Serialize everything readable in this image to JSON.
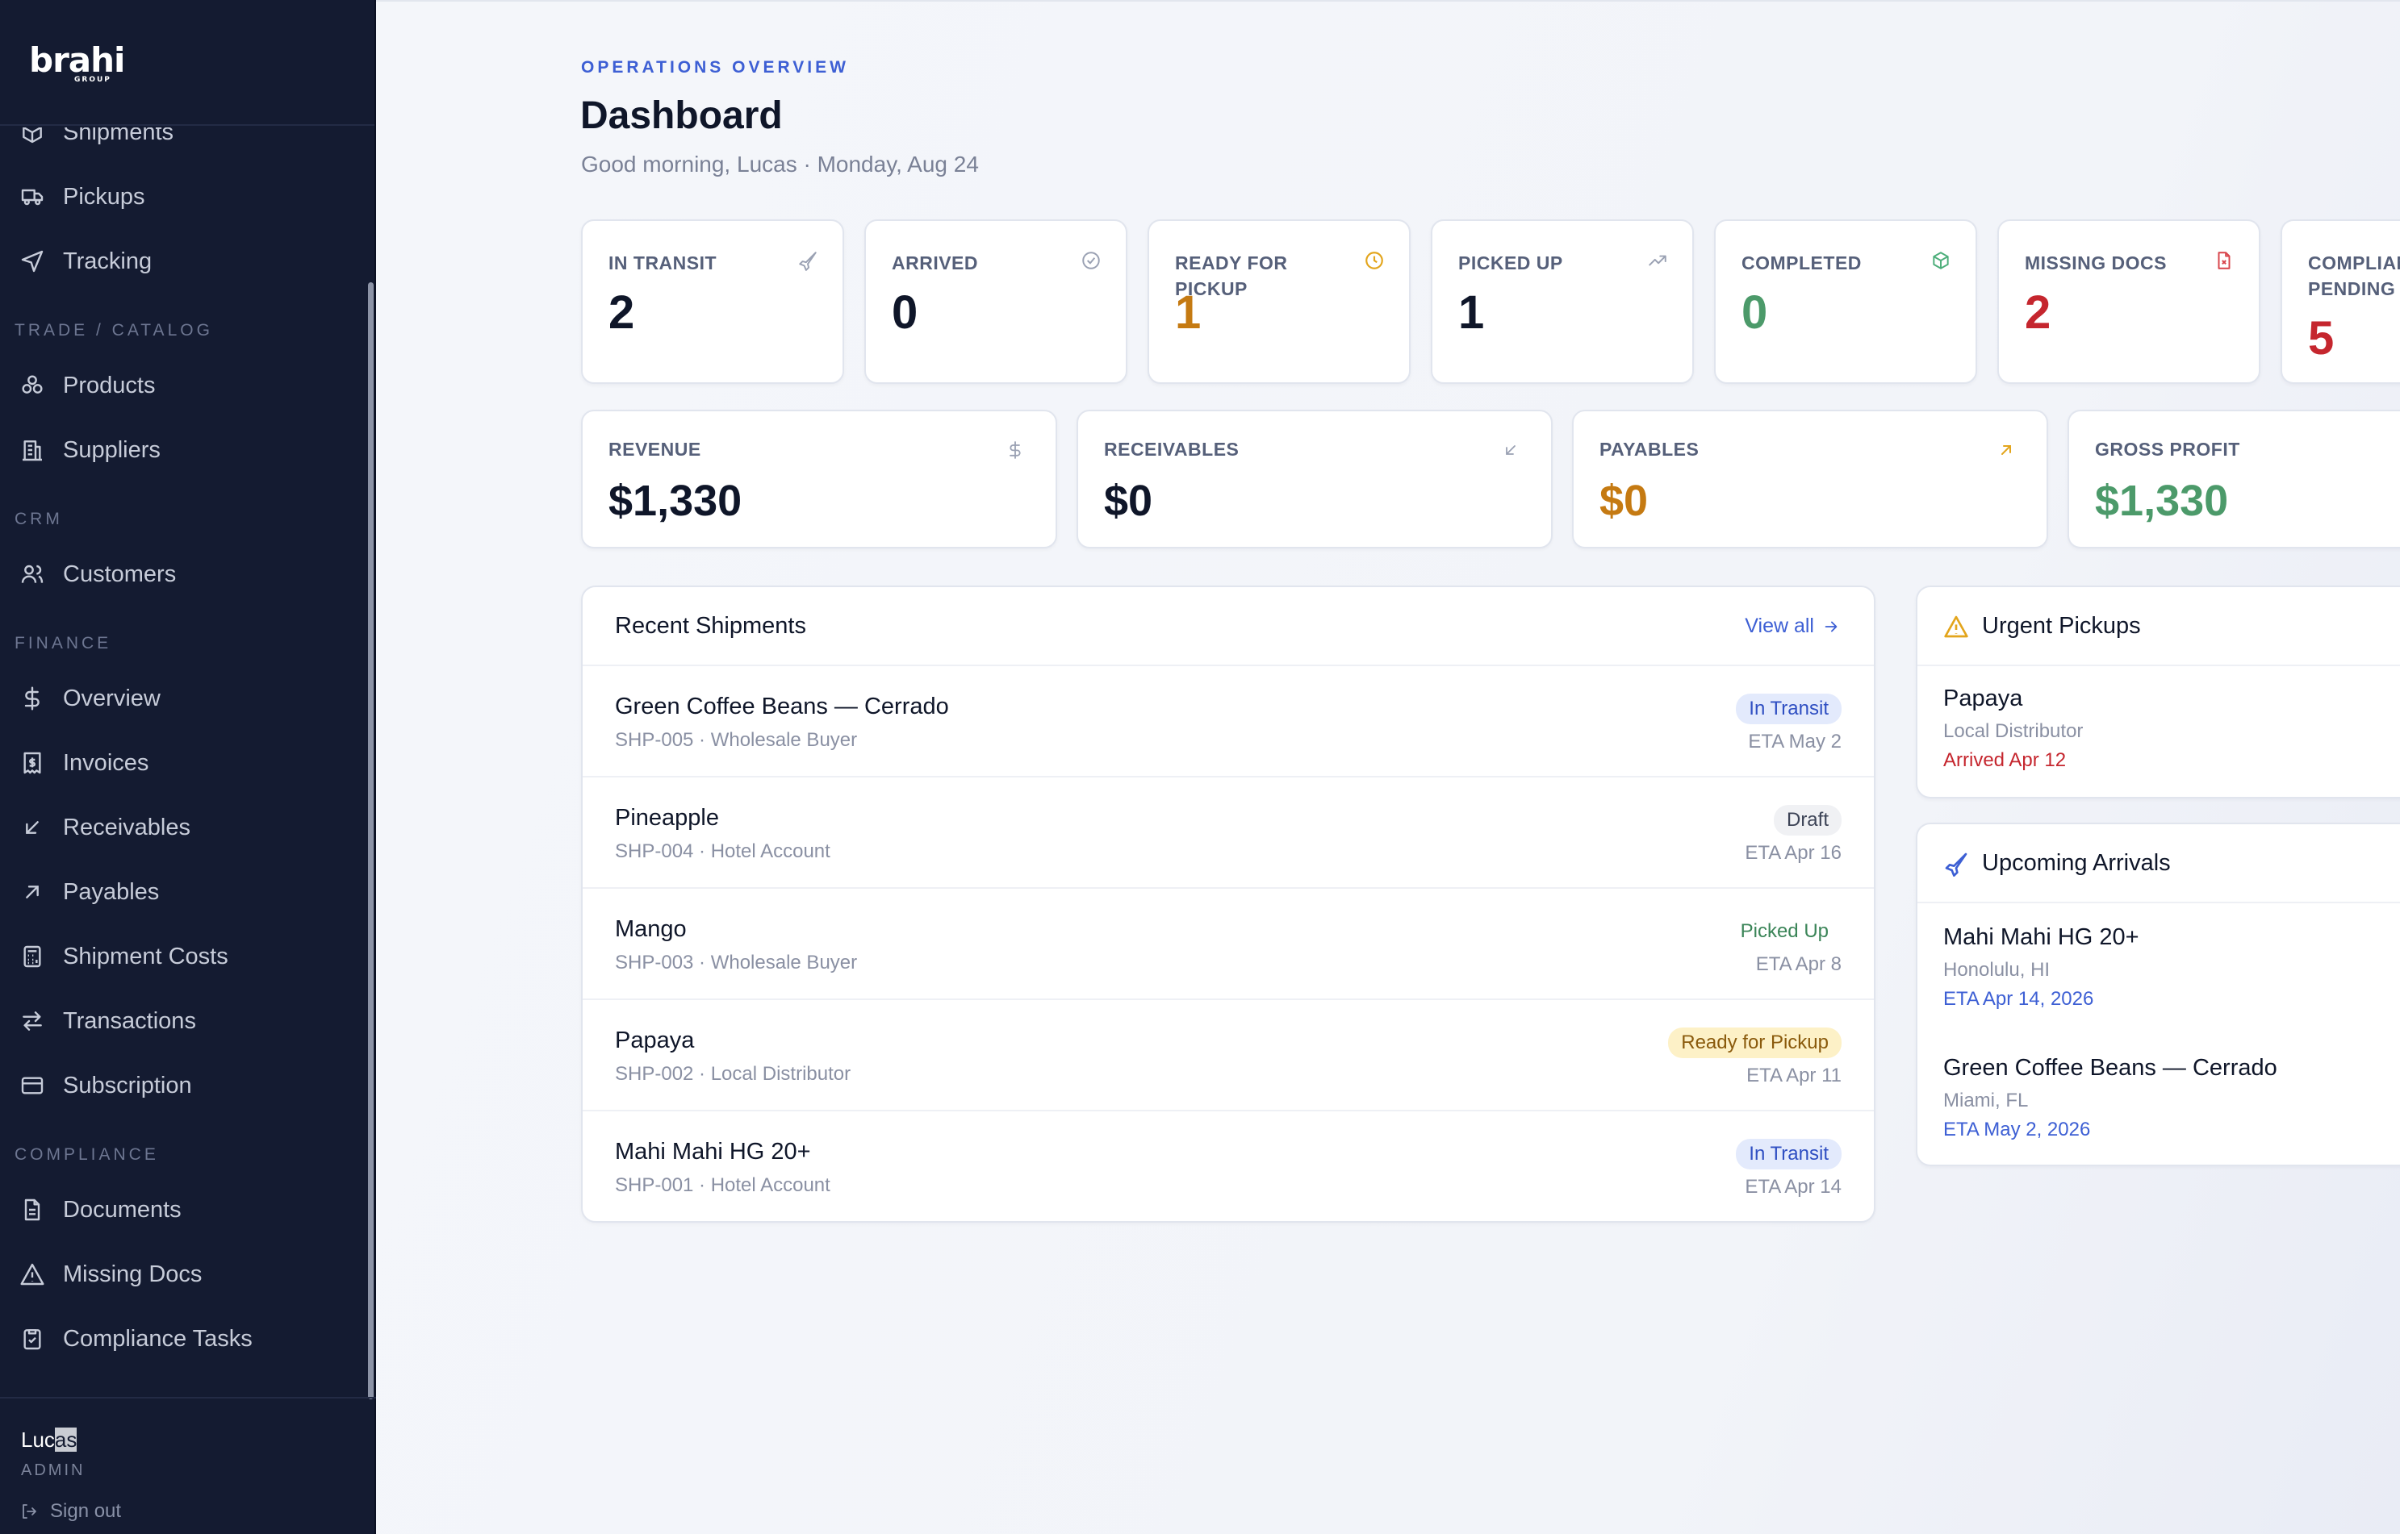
{
  "brand": {
    "wordmark": "brahi",
    "sub": "GROUP"
  },
  "sidebar": {
    "items_top": [
      {
        "label": "Shipments",
        "icon": "box-icon"
      },
      {
        "label": "Pickups",
        "icon": "truck-icon"
      },
      {
        "label": "Tracking",
        "icon": "navigation-icon"
      }
    ],
    "section_trade": "TRADE / CATALOG",
    "items_trade": [
      {
        "label": "Products",
        "icon": "products-icon"
      },
      {
        "label": "Suppliers",
        "icon": "building-icon"
      }
    ],
    "section_crm": "CRM",
    "items_crm": [
      {
        "label": "Customers",
        "icon": "users-icon"
      }
    ],
    "section_finance": "FINANCE",
    "items_finance": [
      {
        "label": "Overview",
        "icon": "dollar-icon"
      },
      {
        "label": "Invoices",
        "icon": "invoice-icon"
      },
      {
        "label": "Receivables",
        "icon": "arrow-down-left-icon"
      },
      {
        "label": "Payables",
        "icon": "arrow-up-right-icon"
      },
      {
        "label": "Shipment Costs",
        "icon": "calculator-icon"
      },
      {
        "label": "Transactions",
        "icon": "swap-icon"
      },
      {
        "label": "Subscription",
        "icon": "credit-card-icon"
      }
    ],
    "section_compliance": "COMPLIANCE",
    "items_compliance": [
      {
        "label": "Documents",
        "icon": "document-icon"
      },
      {
        "label": "Missing Docs",
        "icon": "warning-icon"
      },
      {
        "label": "Compliance Tasks",
        "icon": "clipboard-check-icon"
      }
    ],
    "user": {
      "name_a": "Luc",
      "name_b": "as",
      "role": "ADMIN",
      "signout": "Sign out"
    }
  },
  "header": {
    "eyebrow": "OPERATIONS OVERVIEW",
    "title": "Dashboard",
    "greeting": "Good morning, Lucas · Monday, Aug 24"
  },
  "stats": [
    {
      "label": "IN TRANSIT",
      "value": "2",
      "icon": "plane-icon",
      "color": "#0f1629",
      "icon_color": "#9aa1b3"
    },
    {
      "label": "ARRIVED",
      "value": "0",
      "icon": "check-circle-icon",
      "color": "#0f1629",
      "icon_color": "#9aa1b3"
    },
    {
      "label": "READY FOR PICKUP",
      "value": "1",
      "icon": "clock-icon",
      "color": "#c57a12",
      "icon_color": "#e3a51c"
    },
    {
      "label": "PICKED UP",
      "value": "1",
      "icon": "trending-up-icon",
      "color": "#0f1629",
      "icon_color": "#9aa1b3"
    },
    {
      "label": "COMPLETED",
      "value": "0",
      "icon": "package-icon",
      "color": "#4c9a6a",
      "icon_color": "#4cae7a"
    },
    {
      "label": "MISSING DOCS",
      "value": "2",
      "icon": "file-x-icon",
      "color": "#c5262e",
      "icon_color": "#d8434a"
    },
    {
      "label": "COMPLIANCE PENDING",
      "value": "5",
      "icon": "",
      "color": "#c5262e",
      "icon_color": "#9aa1b3"
    }
  ],
  "money": [
    {
      "label": "REVENUE",
      "value": "$1,330",
      "icon": "dollar-icon",
      "color": "#0f1629",
      "icon_color": "#9aa1b3"
    },
    {
      "label": "RECEIVABLES",
      "value": "$0",
      "icon": "arrow-down-left-icon",
      "color": "#0f1629",
      "icon_color": "#9aa1b3"
    },
    {
      "label": "PAYABLES",
      "value": "$0",
      "icon": "arrow-up-right-icon",
      "color": "#c57a12",
      "icon_color": "#e3a51c"
    },
    {
      "label": "GROSS PROFIT",
      "value": "$1,330",
      "icon": "",
      "color": "#4c9a6a",
      "icon_color": "#9aa1b3"
    }
  ],
  "recent": {
    "title": "Recent Shipments",
    "view_all": "View all",
    "rows": [
      {
        "name": "Green Coffee Beans — Cerrado",
        "sub": "SHP-005 · Wholesale Buyer",
        "status": "In Transit",
        "eta": "ETA May 2",
        "badge_bg": "#e3eafc",
        "badge_fg": "#2f4fc2"
      },
      {
        "name": "Pineapple",
        "sub": "SHP-004 · Hotel Account",
        "status": "Draft",
        "eta": "ETA Apr 16",
        "badge_bg": "#f0f1f4",
        "badge_fg": "#3c4356"
      },
      {
        "name": "Mango",
        "sub": "SHP-003 · Wholesale Buyer",
        "status": "Picked Up",
        "eta": "ETA Apr 8",
        "badge_bg": "#ffffff",
        "badge_fg": "#3b8558"
      },
      {
        "name": "Papaya",
        "sub": "SHP-002 · Local Distributor",
        "status": "Ready for Pickup",
        "eta": "ETA Apr 11",
        "badge_bg": "#fdf1c7",
        "badge_fg": "#8a5a0c"
      },
      {
        "name": "Mahi Mahi HG 20+",
        "sub": "SHP-001 · Hotel Account",
        "status": "In Transit",
        "eta": "ETA Apr 14",
        "badge_bg": "#e3eafc",
        "badge_fg": "#2f4fc2"
      }
    ]
  },
  "urgent": {
    "title": "Urgent Pickups",
    "items": [
      {
        "name": "Papaya",
        "sub": "Local Distributor",
        "note": "Arrived Apr 12"
      }
    ]
  },
  "arrivals": {
    "title": "Upcoming Arrivals",
    "items": [
      {
        "name": "Mahi Mahi HG 20+",
        "sub": "Honolulu, HI",
        "note": "ETA Apr 14, 2026"
      },
      {
        "name": "Green Coffee Beans — Cerrado",
        "sub": "Miami, FL",
        "note": "ETA May 2, 2026"
      }
    ]
  },
  "colors": {
    "sidebar_bg": "#141b31",
    "accent": "#3d5fd4",
    "danger": "#c5262e",
    "warning": "#c57a12",
    "success": "#4c9a6a"
  }
}
